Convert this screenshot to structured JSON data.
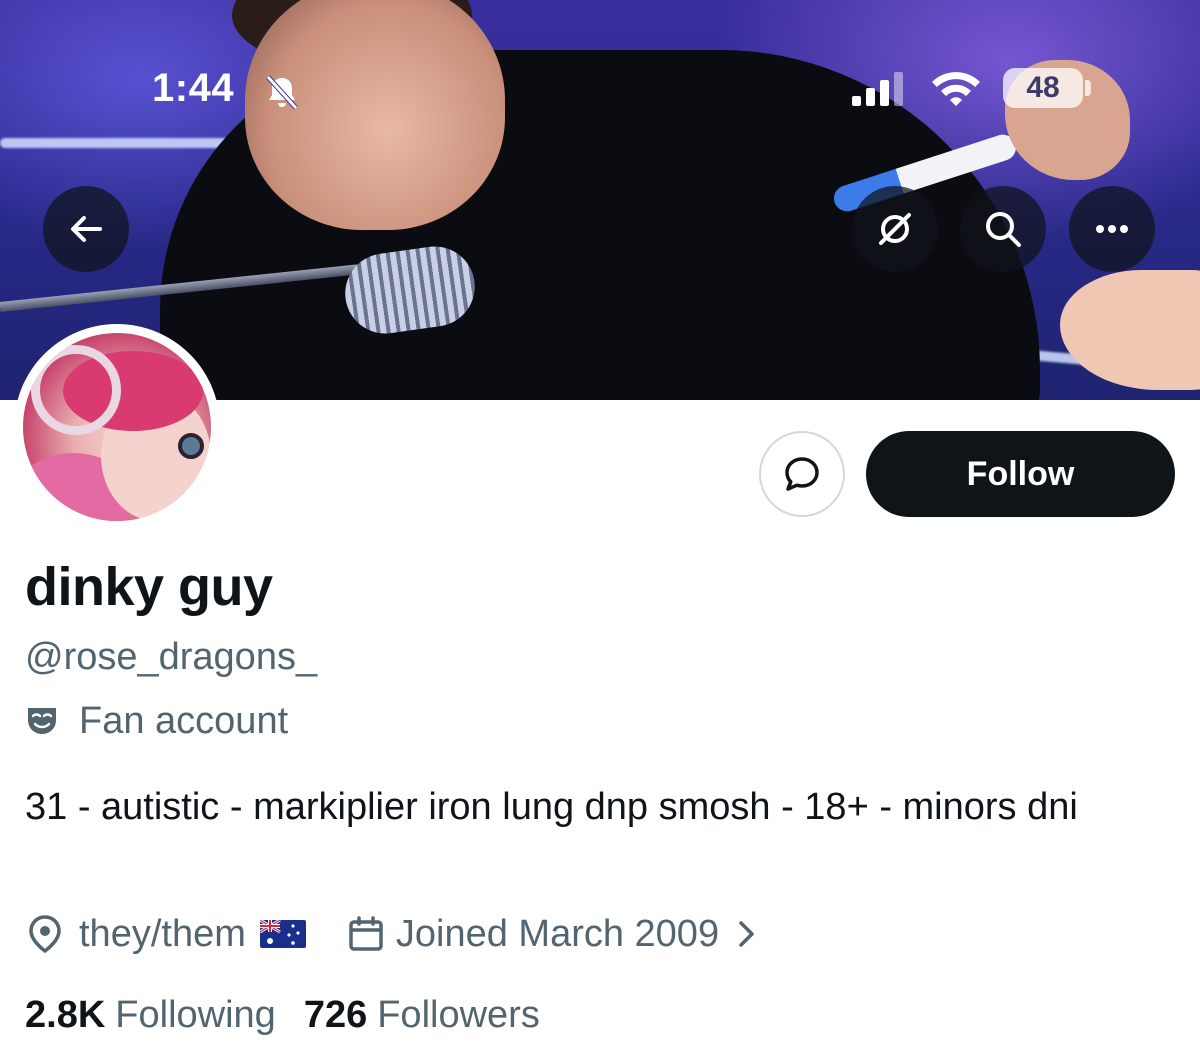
{
  "status_bar": {
    "time": "1:44",
    "battery": "48",
    "icons": [
      "bell-slash-icon",
      "cellular-signal-icon",
      "wifi-icon",
      "battery-icon"
    ]
  },
  "header": {
    "buttons": [
      "back-arrow-icon",
      "grok-icon",
      "search-icon",
      "more-icon"
    ]
  },
  "actions": {
    "message_icon": "message-bubble-icon",
    "follow_label": "Follow"
  },
  "profile": {
    "display_name": "dinky guy",
    "handle": "@rose_dragons_",
    "category": "Fan account",
    "bio": "31 - autistic - markiplier iron lung dnp smosh - 18+ - minors dni",
    "location": "they/them",
    "location_flag": "flag-australia",
    "joined": "Joined March 2009",
    "following_count": "2.8K",
    "following_label": "Following",
    "followers_count": "726",
    "followers_label": "Followers"
  },
  "colors": {
    "text_primary": "#0f1419",
    "text_secondary": "#536471",
    "button_dark": "#0f1419",
    "border": "#cfd9de"
  }
}
